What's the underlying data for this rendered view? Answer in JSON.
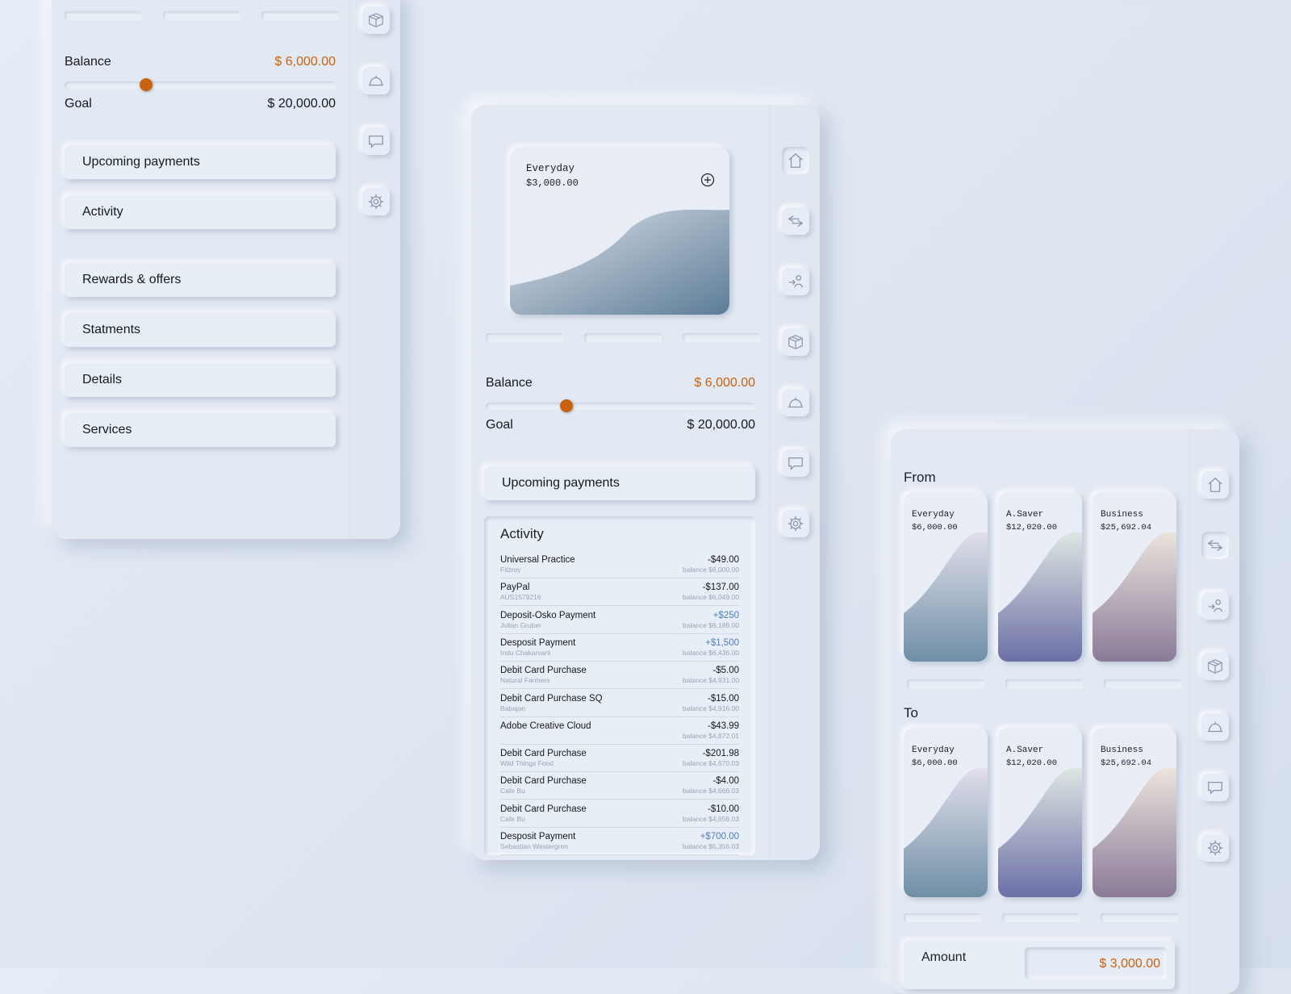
{
  "panel_left": {
    "balance": {
      "label": "Balance",
      "value": "$ 6,000.00"
    },
    "goal": {
      "label": "Goal",
      "value": "$ 20,000.00"
    },
    "progress_fraction": 0.3,
    "menu": [
      "Upcoming payments",
      "Activity",
      "Rewards & offers",
      "Statments",
      "Details",
      "Services"
    ],
    "rail_icons": [
      "box-icon",
      "bell-icon",
      "chat-icon",
      "gear-icon"
    ]
  },
  "panel_middle": {
    "account_card": {
      "name": "Everyday",
      "amount": "$3,000.00"
    },
    "balance": {
      "label": "Balance",
      "value": "$ 6,000.00"
    },
    "goal": {
      "label": "Goal",
      "value": "$ 20,000.00"
    },
    "progress_fraction": 0.3,
    "upcoming_label": "Upcoming payments",
    "activity": {
      "title": "Activity",
      "rows": [
        {
          "name": "Universal Practice",
          "sub": "Fitzroy",
          "amount": "-$49.00",
          "balance": "balance $6,000.00",
          "positive": false
        },
        {
          "name": "PayPal",
          "sub": "AUS1579216",
          "amount": "-$137.00",
          "balance": "balance $6,049.00",
          "positive": false
        },
        {
          "name": "Deposit-Osko Payment",
          "sub": "Julian Gruber",
          "amount": "+$250",
          "balance": "balance $6,186.00",
          "positive": true
        },
        {
          "name": "Desposit Payment",
          "sub": "Indu Chakarvarti",
          "amount": "+$1,500",
          "balance": "balance $6,436.00",
          "positive": true
        },
        {
          "name": "Debit Card Purchase",
          "sub": "Natural Farmers",
          "amount": "-$5.00",
          "balance": "balance $4,931.00",
          "positive": false
        },
        {
          "name": "Debit Card Purchase SQ",
          "sub": "Babajan",
          "amount": "-$15.00",
          "balance": "balance $4,916.00",
          "positive": false
        },
        {
          "name": "Adobe Creative Cloud",
          "sub": "",
          "amount": "-$43.99",
          "balance": "balance $4,872.01",
          "positive": false
        },
        {
          "name": "Debit Card Purchase",
          "sub": "Wild Things Food",
          "amount": "-$201.98",
          "balance": "balance $4,670.03",
          "positive": false
        },
        {
          "name": "Debit Card Purchase",
          "sub": "Cafe Bu",
          "amount": "-$4.00",
          "balance": "balance $4,666.03",
          "positive": false
        },
        {
          "name": "Debit Card Purchase",
          "sub": "Cafe Bu",
          "amount": "-$10.00",
          "balance": "balance $4,656.03",
          "positive": false
        },
        {
          "name": "Desposit Payment",
          "sub": "Sebastian Westergren",
          "amount": "+$700.00",
          "balance": "balance $5,356.03",
          "positive": true
        }
      ]
    },
    "rail_icons": [
      "home-icon",
      "transfer-icon",
      "pay-person-icon",
      "box-icon",
      "bell-icon",
      "chat-icon",
      "gear-icon"
    ]
  },
  "panel_right": {
    "from_label": "From",
    "to_label": "To",
    "from_cards": [
      {
        "name": "Everyday",
        "amount": "$6,000.00",
        "accent": "#6f8fa6"
      },
      {
        "name": "A.Saver",
        "amount": "$12,020.00",
        "accent": "#6c6fa6"
      },
      {
        "name": "Business",
        "amount": "$25,692.04",
        "accent": "#8a7a98"
      }
    ],
    "to_cards": [
      {
        "name": "Everyday",
        "amount": "$6,000.00",
        "accent": "#6f8fa6"
      },
      {
        "name": "A.Saver",
        "amount": "$12,020.00",
        "accent": "#6c6fa6"
      },
      {
        "name": "Business",
        "amount": "$25,692.04",
        "accent": "#8a7a98"
      }
    ],
    "amount": {
      "label": "Amount",
      "value": "$ 3,000.00"
    },
    "rail_icons": [
      "home-icon",
      "transfer-icon",
      "pay-person-icon",
      "box-icon",
      "bell-icon",
      "chat-icon",
      "gear-icon"
    ]
  },
  "colors": {
    "accent_orange": "#c9620f",
    "positive_blue": "#4f7fc2"
  }
}
